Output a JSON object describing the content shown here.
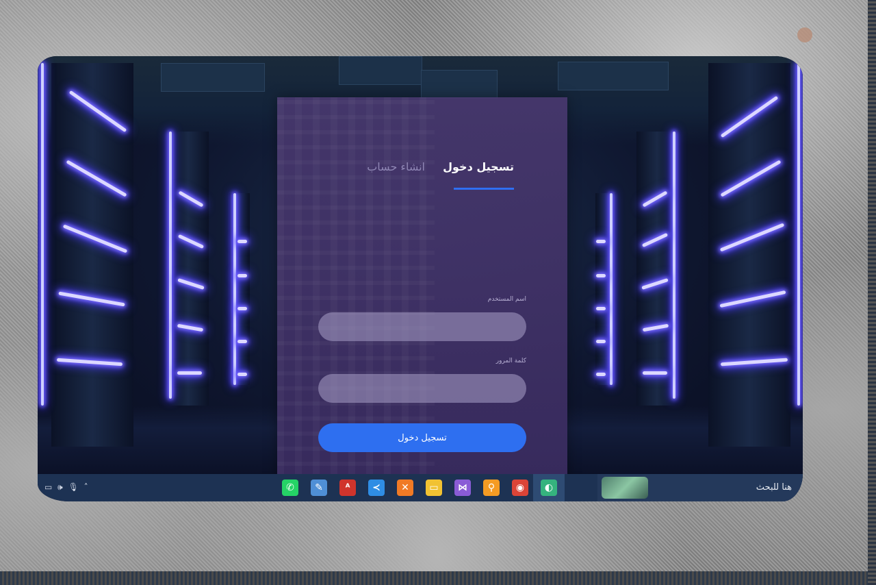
{
  "login_panel": {
    "tabs": {
      "login": "تسجيل دخول",
      "signup": "انشاء حساب"
    },
    "username_label": "اسم المستخدم",
    "username_value": "",
    "password_label": "كلمة المرور",
    "password_value": "",
    "submit_label": "تسجيل دخول"
  },
  "taskbar": {
    "search_text": "هنا للبحث",
    "apps": [
      {
        "icon": "whatsapp-icon",
        "glyph": "✆",
        "color": "#25d366"
      },
      {
        "icon": "notepad-icon",
        "glyph": "✎",
        "color": "#4f8fd6"
      },
      {
        "icon": "acrobat-icon",
        "glyph": "ᴬ",
        "color": "#d0342c"
      },
      {
        "icon": "vscode-icon",
        "glyph": "≺",
        "color": "#2f8de4"
      },
      {
        "icon": "xampp-icon",
        "glyph": "✕",
        "color": "#f07a25"
      },
      {
        "icon": "file-explorer-icon",
        "glyph": "▭",
        "color": "#f1c232"
      },
      {
        "icon": "visual-studio-icon",
        "glyph": "⋈",
        "color": "#8a5cd6"
      },
      {
        "icon": "search-tool-icon",
        "glyph": "⚲",
        "color": "#f59b23"
      },
      {
        "icon": "chrome-icon",
        "glyph": "◉",
        "color": "#db4437"
      },
      {
        "icon": "edge-icon",
        "glyph": "◐",
        "color": "#35b37e"
      }
    ]
  }
}
